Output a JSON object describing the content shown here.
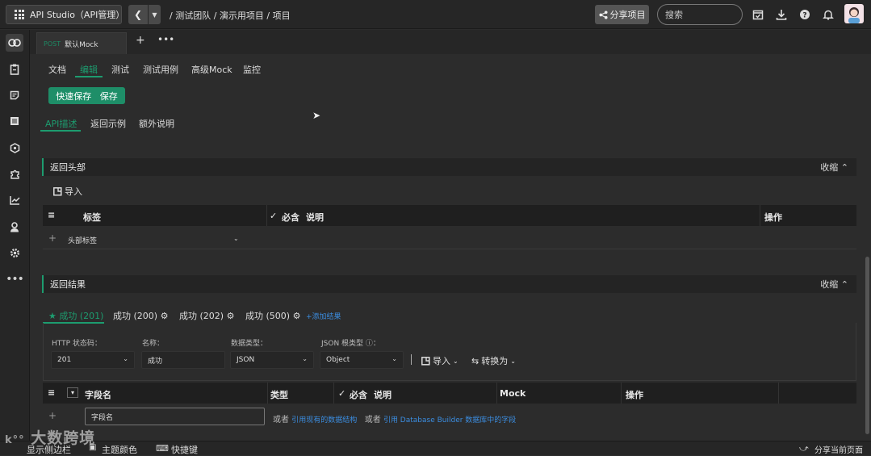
{
  "topbar": {
    "app_title": "API Studio（API管理）",
    "breadcrumb": "/ 测试团队 / 演示用项目 / 项目",
    "share_label": "分享项目",
    "search_placeholder": "搜索"
  },
  "doc_tab": {
    "method": "POST",
    "name": "默认Mock"
  },
  "subnav": {
    "items": [
      "文档",
      "编辑",
      "测试",
      "测试用例",
      "高级Mock",
      "监控"
    ],
    "active": "编辑"
  },
  "actions": {
    "quick_save": "快速保存",
    "save": "保存"
  },
  "desc_tabs": {
    "items": [
      "API描述",
      "返回示例",
      "额外说明"
    ],
    "active": "API描述"
  },
  "headers_section": {
    "title": "返回头部",
    "collapse": "收缩",
    "import": "导入",
    "columns": [
      "标签",
      "必含",
      "说明",
      "操作"
    ],
    "row_placeholder": "头部标签"
  },
  "result_section": {
    "title": "返回结果",
    "collapse": "收缩",
    "tabs": [
      "成功 (201)",
      "成功 (200)",
      "成功 (202)",
      "成功 (500)"
    ],
    "add_result": "+添加结果",
    "labels": {
      "http_code": "HTTP 状态码：",
      "name": "名称：",
      "data_type": "数据类型：",
      "json_root": "JSON 根类型 ⓘ："
    },
    "values": {
      "http_code": "201",
      "name": "成功",
      "data_type": "JSON",
      "json_root": "Object"
    },
    "import": "导入",
    "convert": "转换为",
    "columns": [
      "字段名",
      "类型",
      "必含",
      "说明",
      "Mock",
      "操作"
    ],
    "field_placeholder": "字段名",
    "ref_text_1": "或者",
    "ref_link_1": "引用现有的数据结构",
    "ref_text_2": "或者",
    "ref_link_2": "引用 Database Builder 数据库中的字段"
  },
  "statusbar": {
    "sidebar": "显示侧边栏",
    "theme": "主题颜色",
    "shortcut": "快捷键",
    "share_page": "分享当前页面"
  },
  "watermark": "大数跨境",
  "colors": {
    "accent": "#1d9c6f",
    "link": "#3b8de0",
    "background": "#2c2c2c"
  }
}
